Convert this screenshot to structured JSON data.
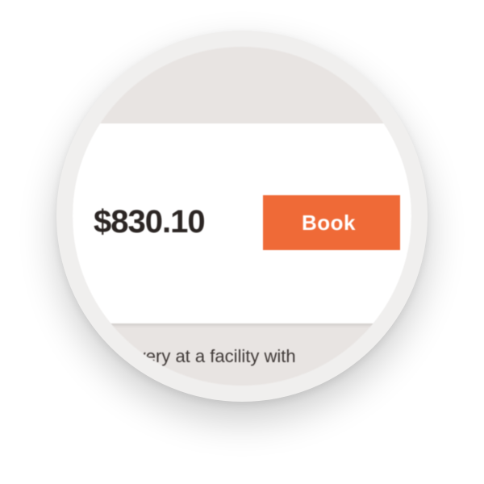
{
  "offer": {
    "price": "$830.10",
    "book_label": "Book",
    "button_color": "#ef6a37"
  },
  "description": {
    "text": "livery at a facility with"
  }
}
